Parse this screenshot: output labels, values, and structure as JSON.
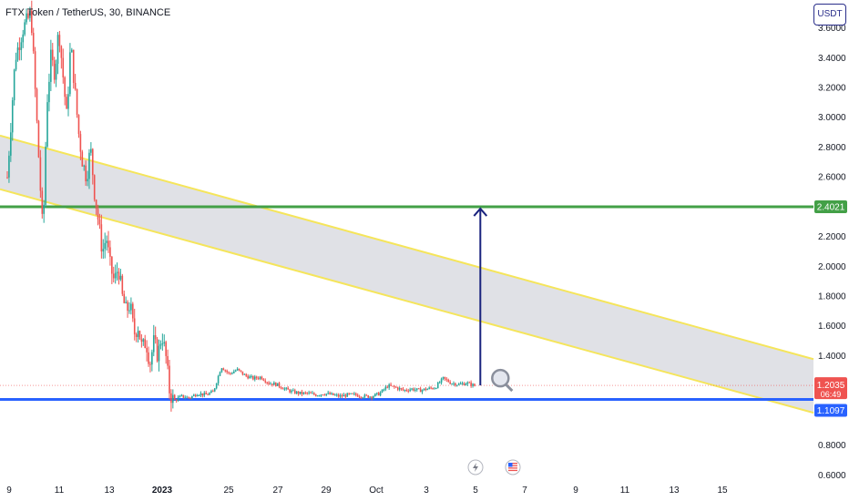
{
  "header": {
    "title": "FTX Token / TetherUS, 30, BINANCE",
    "currency": "USDT"
  },
  "colors": {
    "bull": "#26a69a",
    "bear": "#ef5350",
    "channel_line": "#f5e55b",
    "channel_fill": "#c7c8d1",
    "resistance": "#43a047",
    "support": "#2962ff",
    "arrow": "#1a237e",
    "current_price_bg": "#ef5350",
    "support_label_bg": "#2962ff",
    "resistance_label_bg": "#43a047"
  },
  "chart_data": {
    "type": "candlestick",
    "y_axis": {
      "ticks": [
        "3.6000",
        "3.4000",
        "3.2000",
        "3.0000",
        "2.8000",
        "2.6000",
        "2.2000",
        "2.0000",
        "1.8000",
        "1.6000",
        "1.4000",
        "0.8000",
        "0.6000"
      ],
      "tick_values": [
        3.6,
        3.4,
        3.2,
        3.0,
        2.8,
        2.6,
        2.2,
        2.0,
        1.8,
        1.6,
        1.4,
        0.8,
        0.6
      ],
      "range": [
        0.55,
        3.68
      ]
    },
    "x_axis": {
      "ticks": [
        "9",
        "11",
        "13",
        "2023",
        "25",
        "27",
        "29",
        "Oct",
        "3",
        "5",
        "7",
        "9",
        "11",
        "13",
        "15"
      ]
    },
    "price_labels": {
      "resistance": "2.4021",
      "current": "1.2035",
      "countdown": "06:49",
      "support": "1.1097"
    },
    "resistance_level": 2.4021,
    "support_level": 1.1097,
    "current_price": 1.2035,
    "channel": {
      "upper": {
        "start": 2.88,
        "end": 1.38
      },
      "lower": {
        "start": 2.52,
        "end": 1.02
      }
    },
    "arrow": {
      "from": 1.2035,
      "to": 2.4021
    },
    "price_path": [
      [
        0.0,
        2.6
      ],
      [
        0.01,
        3.4
      ],
      [
        0.02,
        3.6
      ],
      [
        0.03,
        3.7
      ],
      [
        0.04,
        2.7
      ],
      [
        0.045,
        2.2
      ],
      [
        0.05,
        3.1
      ],
      [
        0.055,
        3.4
      ],
      [
        0.06,
        3.3
      ],
      [
        0.065,
        3.6
      ],
      [
        0.07,
        3.3
      ],
      [
        0.075,
        3.0
      ],
      [
        0.08,
        3.5
      ],
      [
        0.085,
        3.2
      ],
      [
        0.09,
        2.9
      ],
      [
        0.095,
        2.7
      ],
      [
        0.1,
        2.6
      ],
      [
        0.105,
        2.8
      ],
      [
        0.11,
        2.5
      ],
      [
        0.115,
        2.3
      ],
      [
        0.12,
        2.1
      ],
      [
        0.125,
        2.2
      ],
      [
        0.13,
        2.0
      ],
      [
        0.135,
        1.9
      ],
      [
        0.14,
        2.0
      ],
      [
        0.145,
        1.8
      ],
      [
        0.15,
        1.7
      ],
      [
        0.155,
        1.75
      ],
      [
        0.16,
        1.55
      ],
      [
        0.165,
        1.6
      ],
      [
        0.17,
        1.45
      ],
      [
        0.175,
        1.5
      ],
      [
        0.18,
        1.35
      ],
      [
        0.185,
        1.5
      ],
      [
        0.19,
        1.4
      ],
      [
        0.195,
        1.55
      ],
      [
        0.2,
        1.4
      ],
      [
        0.205,
        1.15
      ],
      [
        0.21,
        1.1
      ],
      [
        0.22,
        1.13
      ],
      [
        0.23,
        1.12
      ],
      [
        0.24,
        1.15
      ],
      [
        0.25,
        1.14
      ],
      [
        0.26,
        1.16
      ],
      [
        0.27,
        1.33
      ],
      [
        0.28,
        1.28
      ],
      [
        0.29,
        1.31
      ],
      [
        0.3,
        1.27
      ],
      [
        0.31,
        1.25
      ],
      [
        0.32,
        1.26
      ],
      [
        0.33,
        1.22
      ],
      [
        0.34,
        1.21
      ],
      [
        0.35,
        1.18
      ],
      [
        0.36,
        1.16
      ],
      [
        0.37,
        1.15
      ],
      [
        0.38,
        1.15
      ],
      [
        0.39,
        1.14
      ],
      [
        0.4,
        1.15
      ],
      [
        0.41,
        1.14
      ],
      [
        0.42,
        1.13
      ],
      [
        0.43,
        1.14
      ],
      [
        0.44,
        1.14
      ],
      [
        0.45,
        1.13
      ],
      [
        0.46,
        1.13
      ],
      [
        0.47,
        1.15
      ],
      [
        0.48,
        1.2
      ],
      [
        0.49,
        1.19
      ],
      [
        0.5,
        1.17
      ],
      [
        0.51,
        1.18
      ],
      [
        0.52,
        1.17
      ],
      [
        0.53,
        1.18
      ],
      [
        0.54,
        1.19
      ],
      [
        0.55,
        1.25
      ],
      [
        0.56,
        1.22
      ],
      [
        0.57,
        1.21
      ],
      [
        0.58,
        1.22
      ],
      [
        0.59,
        1.2
      ]
    ]
  }
}
